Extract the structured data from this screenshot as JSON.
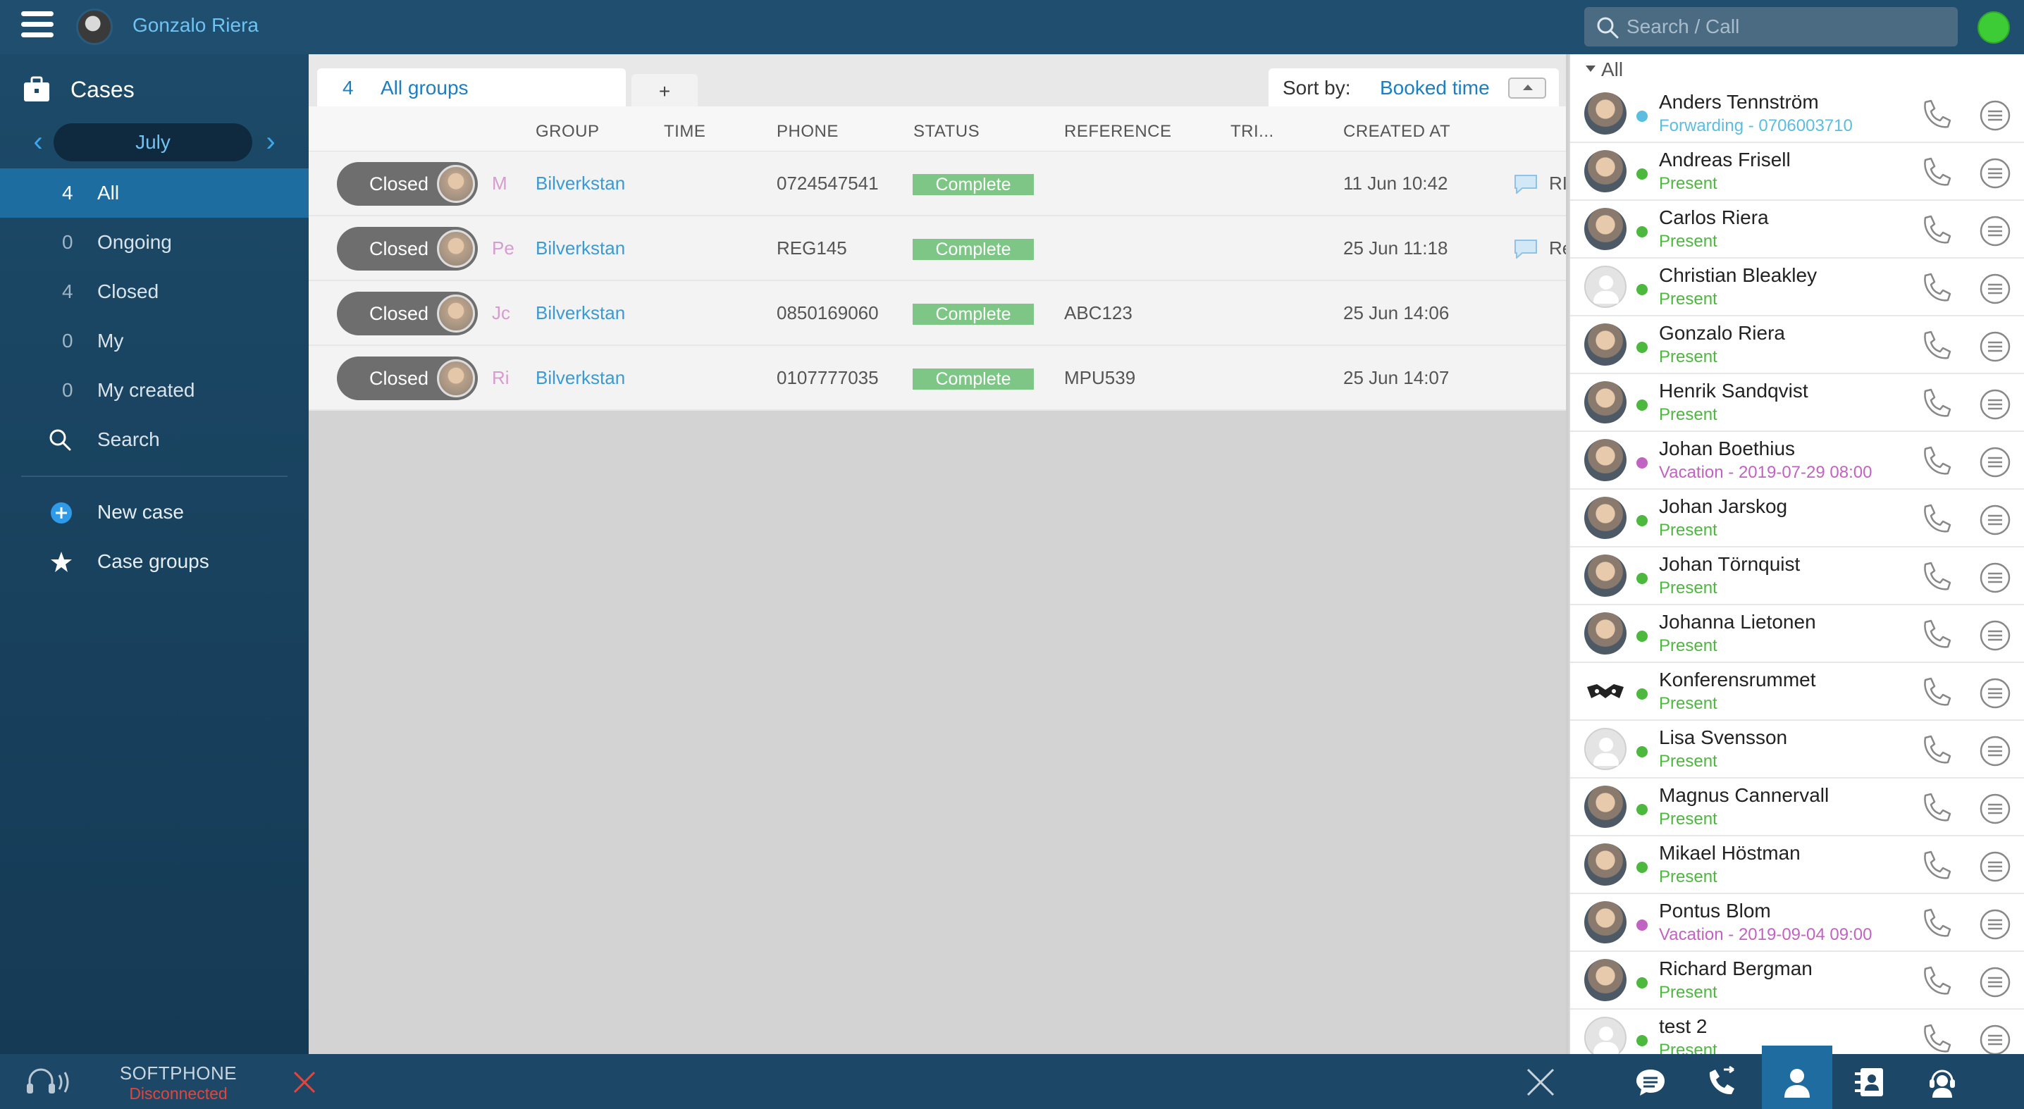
{
  "topbar": {
    "username": "Gonzalo Riera",
    "search_placeholder": "Search / Call"
  },
  "sidebar": {
    "title": "Cases",
    "month": "July",
    "filters": [
      {
        "count": "4",
        "label": "All",
        "active": true
      },
      {
        "count": "0",
        "label": "Ongoing"
      },
      {
        "count": "4",
        "label": "Closed"
      },
      {
        "count": "0",
        "label": "My"
      },
      {
        "count": "0",
        "label": "My created"
      }
    ],
    "search_label": "Search",
    "new_case_label": "New case",
    "case_groups_label": "Case groups"
  },
  "main": {
    "tab": {
      "count": "4",
      "label": "All groups"
    },
    "add_tab_label": "+",
    "sort_label": "Sort by:",
    "sort_value": "Booked time",
    "columns": [
      "GROUP",
      "TIME",
      "PHONE",
      "STATUS",
      "REFERENCE",
      "TRI...",
      "CREATED AT"
    ],
    "rows": [
      {
        "state": "Closed",
        "initial": "M",
        "group": "Bilverkstan",
        "time": "",
        "phone": "0724547541",
        "status": "Complete",
        "reference": "",
        "created": "11 Jun 10:42",
        "extra": "RI"
      },
      {
        "state": "Closed",
        "initial": "Pe",
        "group": "Bilverkstan",
        "time": "",
        "phone": "REG145",
        "status": "Complete",
        "reference": "",
        "created": "25 Jun 11:18",
        "extra": "Re"
      },
      {
        "state": "Closed",
        "initial": "Jc",
        "group": "Bilverkstan",
        "time": "",
        "phone": "0850169060",
        "status": "Complete",
        "reference": "ABC123",
        "created": "25 Jun 14:06",
        "extra": ""
      },
      {
        "state": "Closed",
        "initial": "Ri",
        "group": "Bilverkstan",
        "time": "",
        "phone": "0107777035",
        "status": "Complete",
        "reference": "MPU539",
        "created": "25 Jun 14:07",
        "extra": ""
      }
    ]
  },
  "contacts": {
    "header": "All",
    "list": [
      {
        "name": "Anders Tennström",
        "status": "Forwarding - 0706003710",
        "color": "#5bbde0"
      },
      {
        "name": "Andreas Frisell",
        "status": "Present",
        "color": "#4cb83e"
      },
      {
        "name": "Carlos Riera",
        "status": "Present",
        "color": "#4cb83e"
      },
      {
        "name": "Christian Bleakley",
        "status": "Present",
        "color": "#4cb83e"
      },
      {
        "name": "Gonzalo Riera",
        "status": "Present",
        "color": "#4cb83e"
      },
      {
        "name": "Henrik Sandqvist",
        "status": "Present",
        "color": "#4cb83e"
      },
      {
        "name": "Johan Boethius",
        "status": "Vacation - 2019-07-29 08:00",
        "color": "#c163c2"
      },
      {
        "name": "Johan Jarskog",
        "status": "Present",
        "color": "#4cb83e"
      },
      {
        "name": "Johan Törnquist",
        "status": "Present",
        "color": "#4cb83e"
      },
      {
        "name": "Johanna Lietonen",
        "status": "Present",
        "color": "#4cb83e"
      },
      {
        "name": "Konferensrummet",
        "status": "Present",
        "color": "#4cb83e"
      },
      {
        "name": "Lisa Svensson",
        "status": "Present",
        "color": "#4cb83e"
      },
      {
        "name": "Magnus Cannervall",
        "status": "Present",
        "color": "#4cb83e"
      },
      {
        "name": "Mikael Höstman",
        "status": "Present",
        "color": "#4cb83e"
      },
      {
        "name": "Pontus Blom",
        "status": "Vacation - 2019-09-04 09:00",
        "color": "#c163c2"
      },
      {
        "name": "Richard Bergman",
        "status": "Present",
        "color": "#4cb83e"
      },
      {
        "name": "test 2",
        "status": "Present",
        "color": "#4cb83e"
      }
    ]
  },
  "bottombar": {
    "softphone_label": "SOFTPHONE",
    "softphone_status": "Disconnected"
  }
}
